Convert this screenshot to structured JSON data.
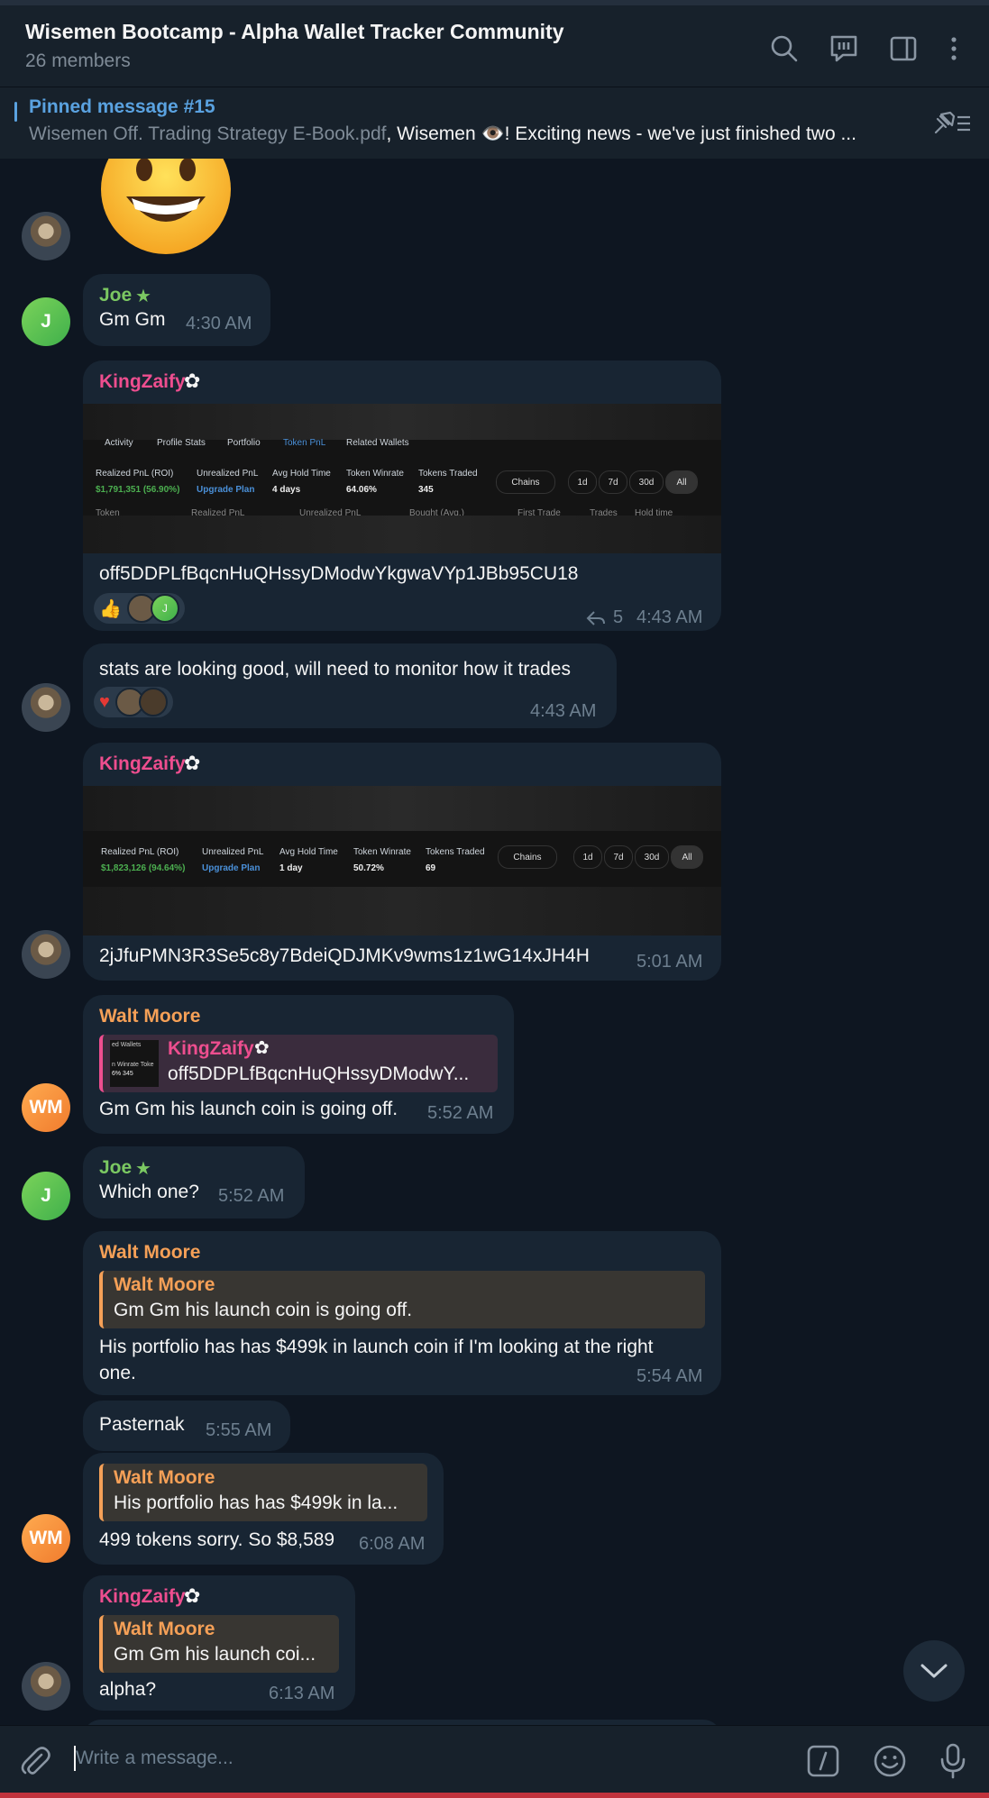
{
  "header": {
    "title": "Wisemen Bootcamp - Alpha Wallet Tracker Community",
    "members": "26 members"
  },
  "pinned": {
    "title": "Pinned message #15",
    "file": "Wisemen Off. Trading Strategy E-Book.pdf",
    "text": ", Wisemen 👁️!   Exciting news - we've just finished two ..."
  },
  "messages": {
    "m1": {
      "name": "Joe",
      "text": "Gm Gm",
      "time": "4:30 AM"
    },
    "m2": {
      "name": "KingZaify",
      "caption": "off5DDPLfBqcnHuQHssyDModwYkgwaVYp1JBb95CU18",
      "forwards": "5",
      "time": "4:43 AM",
      "tabs": [
        "Activity",
        "Profile Stats",
        "Portfolio",
        "Token PnL",
        "Related Wallets"
      ],
      "stats": [
        {
          "label": "Realized PnL (ROI)",
          "value": "$1,791,351 (56.90%)"
        },
        {
          "label": "Unrealized PnL",
          "value": "Upgrade Plan"
        },
        {
          "label": "Avg Hold Time",
          "value": "4 days"
        },
        {
          "label": "Token Winrate",
          "value": "64.06%"
        },
        {
          "label": "Tokens Traded",
          "value": "345"
        }
      ],
      "filters": [
        "Chains",
        "1d",
        "7d",
        "30d",
        "All"
      ],
      "cols": [
        "Token",
        "Realized PnL",
        "Unrealized PnL",
        "Bought (Avg.)",
        "First Trade",
        "Trades",
        "Hold time"
      ]
    },
    "m3": {
      "text": "stats are looking good, will need to monitor how it trades",
      "time": "4:43 AM"
    },
    "m4": {
      "name": "KingZaify",
      "caption": "2jJfuPMN3R3Se5c8y7BdeiQDJMKv9wms1z1wG14xJH4H",
      "time": "5:01 AM",
      "stats": [
        {
          "label": "Realized PnL (ROI)",
          "value": "$1,823,126 (94.64%)"
        },
        {
          "label": "Unrealized PnL",
          "value": "Upgrade Plan"
        },
        {
          "label": "Avg Hold Time",
          "value": "1 day"
        },
        {
          "label": "Token Winrate",
          "value": "50.72%"
        },
        {
          "label": "Tokens Traded",
          "value": "69"
        }
      ],
      "filters": [
        "Chains",
        "1d",
        "7d",
        "30d",
        "All"
      ]
    },
    "m5": {
      "name": "Walt Moore",
      "reply_name": "KingZaify",
      "reply_text": "off5DDPLfBqcnHuQHssyDModwY...",
      "text": "Gm Gm his launch coin is going off.",
      "time": "5:52 AM",
      "thumb_a": "ed Wallets",
      "thumb_b": "n Winrate  Toke",
      "thumb_c": "6%  345"
    },
    "m6": {
      "name": "Joe",
      "text": "Which one?",
      "time": "5:52 AM"
    },
    "m7": {
      "name": "Walt Moore",
      "reply_name": "Walt Moore",
      "reply_text": "Gm Gm his launch coin is going off.",
      "text1": "His portfolio has has $499k in launch coin if I'm looking at the right",
      "text2": "one.",
      "time": "5:54 AM"
    },
    "m8": {
      "text": "Pasternak",
      "time": "5:55 AM"
    },
    "m9": {
      "reply_name": "Walt Moore",
      "reply_text": "His portfolio has has $499k in la...",
      "text": "499 tokens sorry. So $8,589",
      "time": "6:08 AM"
    },
    "m10": {
      "name": "KingZaify",
      "reply_name": "Walt Moore",
      "reply_text": "Gm Gm his launch coi...",
      "text": "alpha?",
      "time": "6:13 AM"
    }
  },
  "avatars": {
    "joe": "J",
    "walt": "WM"
  },
  "composer": {
    "placeholder": "Write a message..."
  },
  "colors": {
    "joe": "#7bc862",
    "king": "#ee4e8f",
    "walt": "#f5a057",
    "link": "#5aa2e0",
    "bg": "#0e1621",
    "bubble": "#182533"
  }
}
